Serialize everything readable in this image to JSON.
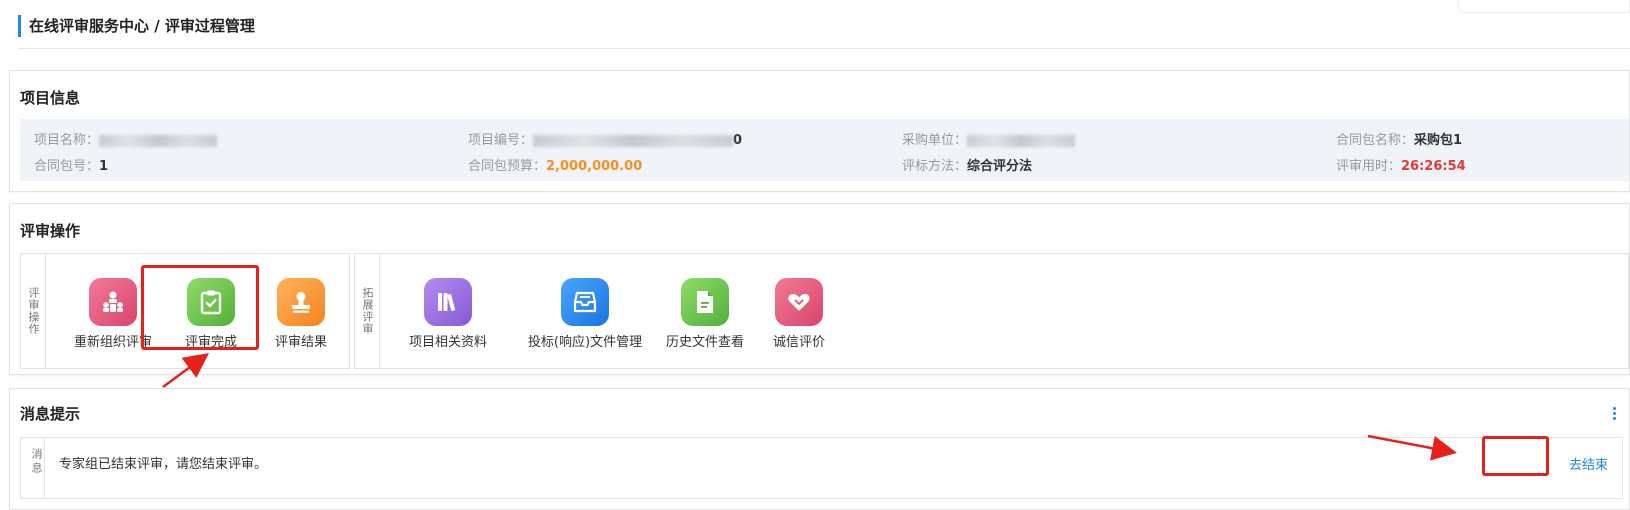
{
  "breadcrumb": "在线评审服务中心 / 评审过程管理",
  "project_info": {
    "title": "项目信息",
    "fields": [
      {
        "label": "项目名称：",
        "value": "",
        "blurred": true
      },
      {
        "label": "项目编号：",
        "value": "0",
        "blurred": true
      },
      {
        "label": "采购单位：",
        "value": "",
        "blurred": true
      },
      {
        "label": "合同包名称：",
        "value": "采购包1"
      },
      {
        "label": "合同包号：",
        "value": "1"
      },
      {
        "label": "合同包预算：",
        "value": "2,000,000.00",
        "color": "#f5901e"
      },
      {
        "label": "评标方法：",
        "value": "综合评分法"
      },
      {
        "label": "评审用时：",
        "value": "26:26:54",
        "color": "#e53935"
      }
    ]
  },
  "review_ops": {
    "title": "评审操作",
    "left_panel_label": "评审操作",
    "right_panel_label": "拓展评审",
    "left_tiles": [
      {
        "label": "重新组织评审",
        "icon": "reorganize-icon",
        "color": "#e8557a"
      },
      {
        "label": "评审完成",
        "icon": "clipboard-check-icon",
        "color": "#6cc24a"
      },
      {
        "label": "评审结果",
        "icon": "stamp-icon",
        "color": "#fb9b3c"
      }
    ],
    "right_tiles": [
      {
        "label": "项目相关资料",
        "icon": "books-icon",
        "color": "#9b6fe0"
      },
      {
        "label": "投标(响应)文件管理",
        "icon": "file-tray-icon",
        "color": "#2d8cf0"
      },
      {
        "label": "历史文件查看",
        "icon": "document-icon",
        "color": "#6cc24a"
      },
      {
        "label": "诚信评价",
        "icon": "heart-icon",
        "color": "#e8557a"
      }
    ]
  },
  "messages": {
    "title": "消息提示",
    "side_label": "消息",
    "text": "专家组已结束评审，请您结束评审。",
    "action": "去结束"
  },
  "colors": {
    "accent": "#1e88e5",
    "highlight": "#e8201a"
  }
}
